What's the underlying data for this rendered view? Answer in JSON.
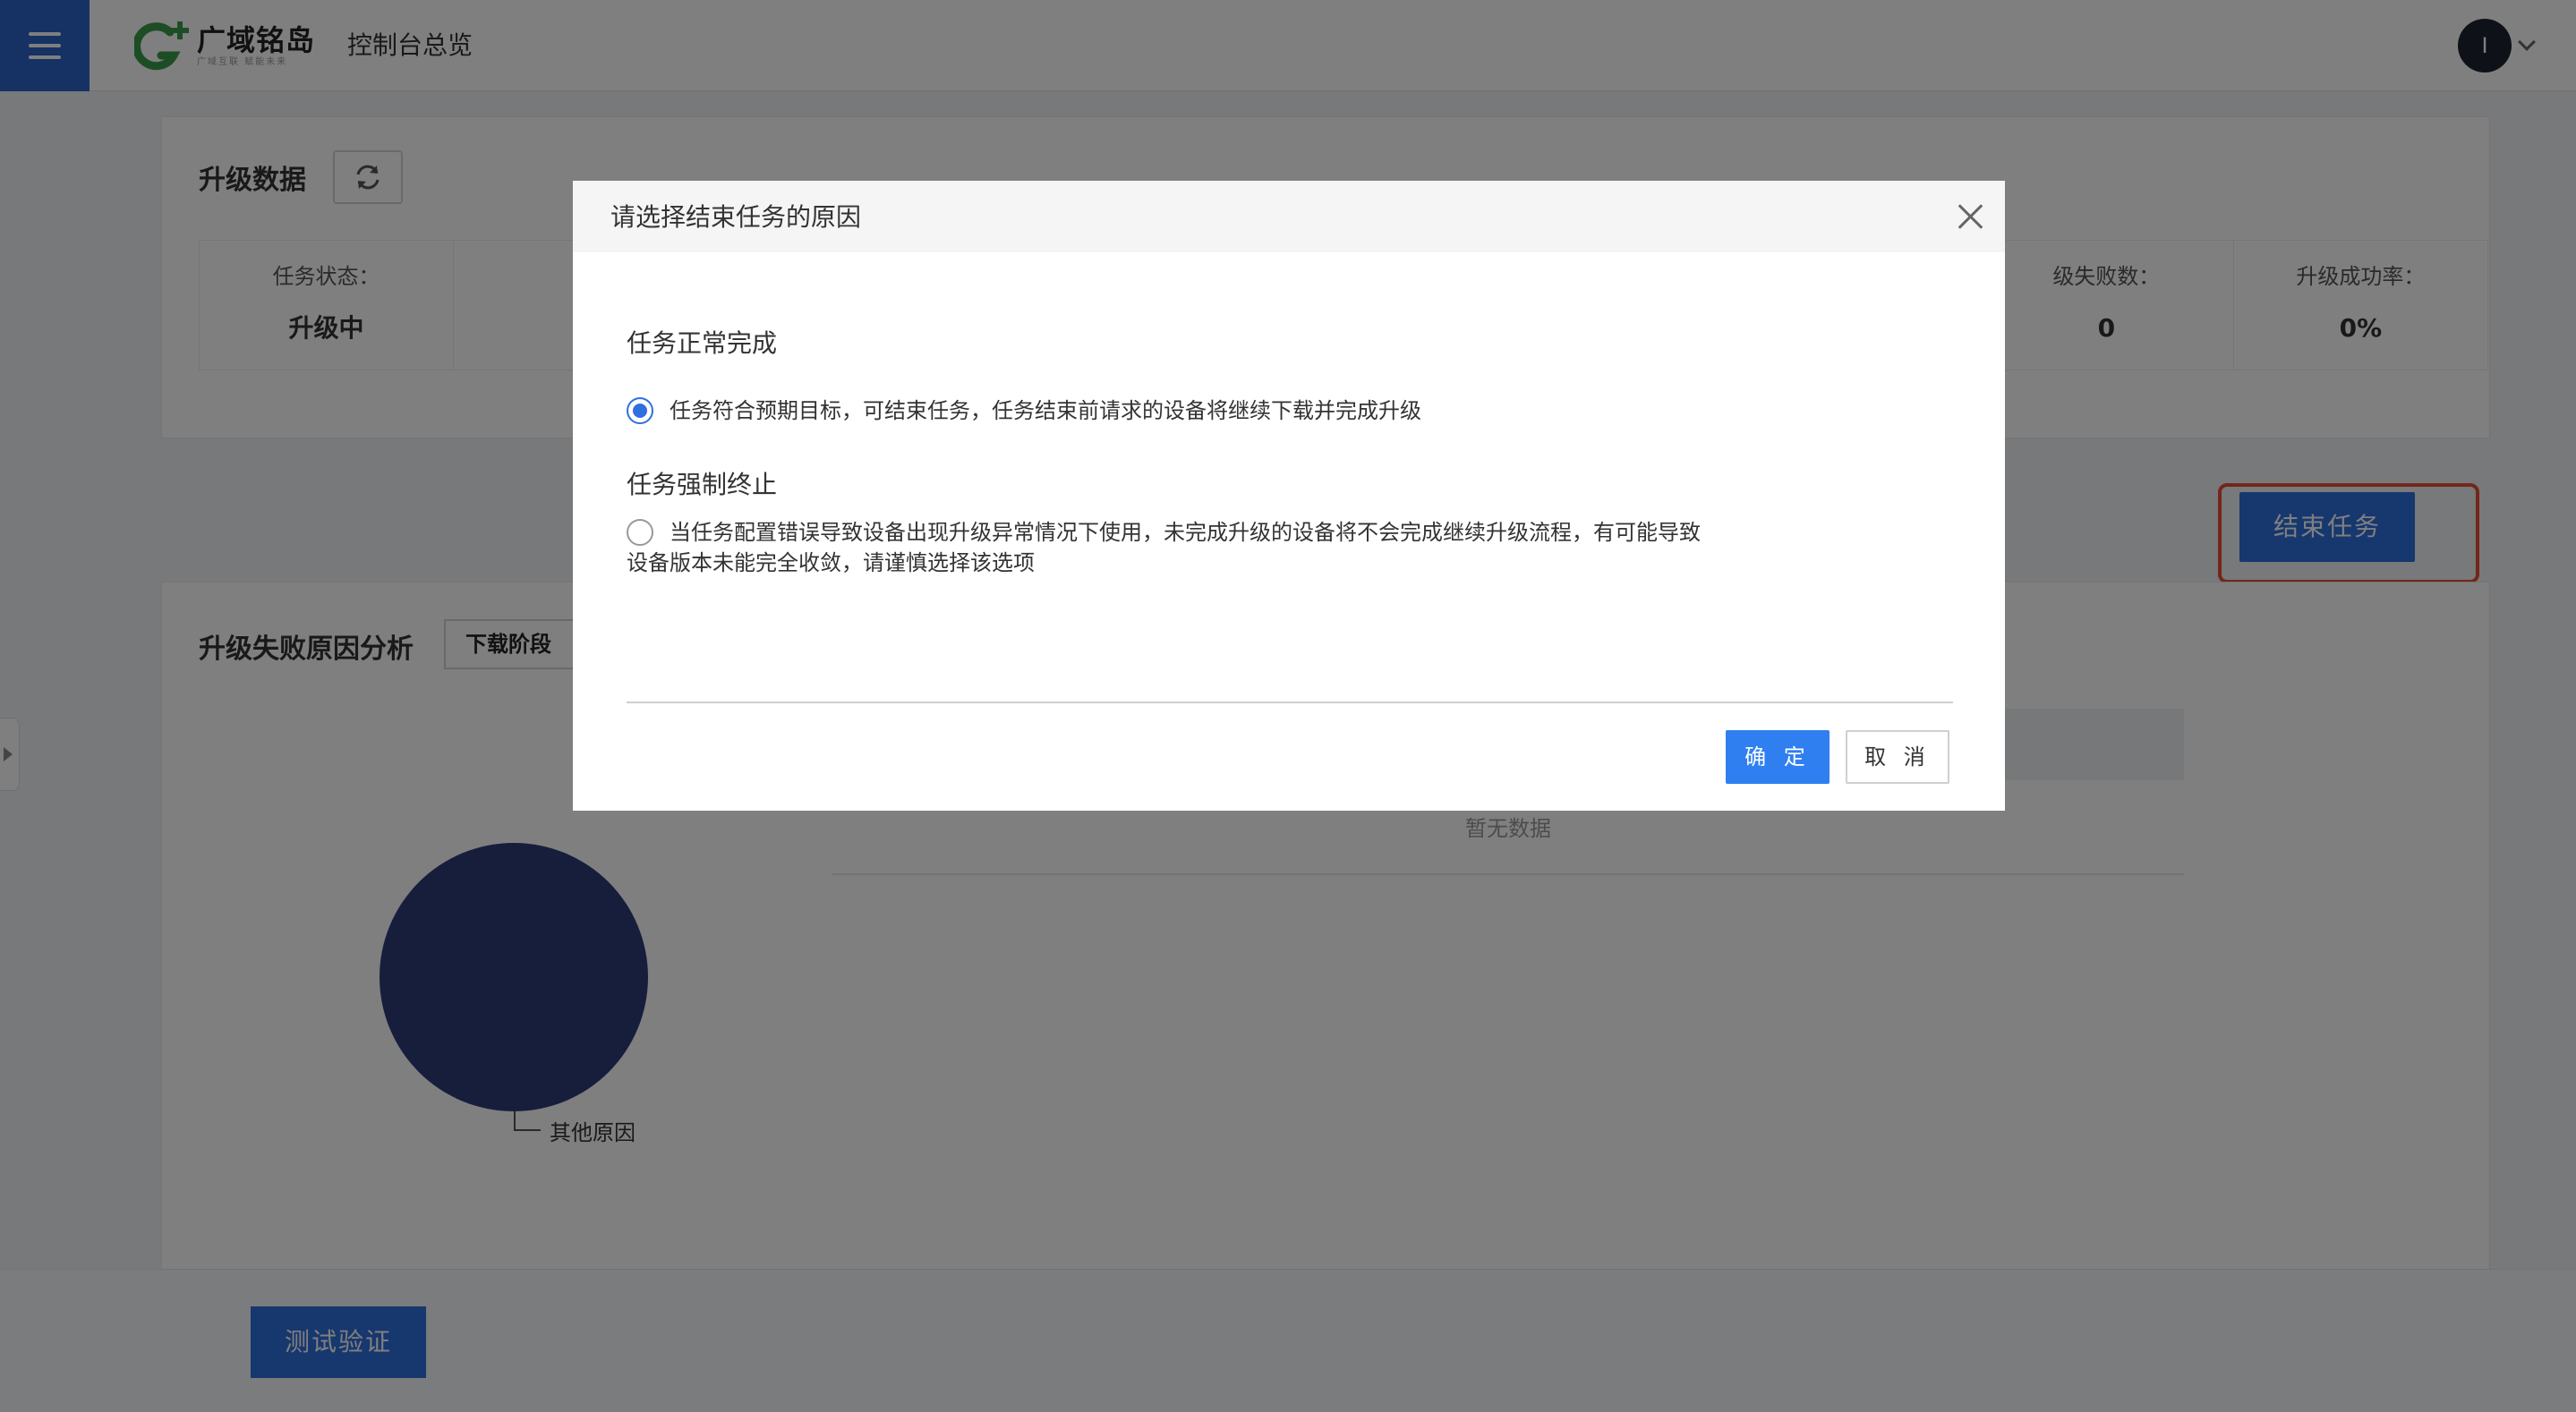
{
  "header": {
    "logo_name": "广域铭岛",
    "logo_sub": "广域互联 赋能未来",
    "title": "控制台总览",
    "avatar_initial": "I"
  },
  "upgrade_data": {
    "title": "升级数据",
    "stats": [
      {
        "label": "任务状态：",
        "value": "升级中"
      },
      {
        "label": "",
        "value": "("
      },
      {
        "label": "",
        "value": ""
      },
      {
        "label": "",
        "value": ""
      },
      {
        "label": "",
        "value": ""
      },
      {
        "label": "",
        "value": ""
      },
      {
        "label": "",
        "value": ""
      },
      {
        "label": "级失败数：",
        "value": "0"
      },
      {
        "label": "升级成功率：",
        "value": "0%"
      }
    ]
  },
  "end_task_button": "结束任务",
  "failure_analysis": {
    "title": "升级失败原因分析",
    "stage_select": "下载阶段",
    "pie_label": "其他原因",
    "empty_text": "暂无数据"
  },
  "chart_data": {
    "type": "pie",
    "categories": [
      "其他原因"
    ],
    "values": [
      100
    ],
    "colors": [
      "#2f3c78"
    ]
  },
  "test_button": "测试验证",
  "modal": {
    "title": "请选择结束任务的原因",
    "section1_title": "任务正常完成",
    "option1_text": "任务符合预期目标，可结束任务，任务结束前请求的设备将继续下载并完成升级",
    "option1_checked": true,
    "section2_title": "任务强制终止",
    "option2_line1": "当任务配置错误导致设备出现升级异常情况下使用，未完成升级的设备将不会完成继续升级流程，有可能导致",
    "option2_line2": "设备版本未能完全收敛，请谨慎选择该选项",
    "ok_label": "确 定",
    "cancel_label": "取 消"
  },
  "colors": {
    "primary": "#2f6fde",
    "highlight_outline": "#e94d35",
    "pie": "#2f3c78"
  }
}
